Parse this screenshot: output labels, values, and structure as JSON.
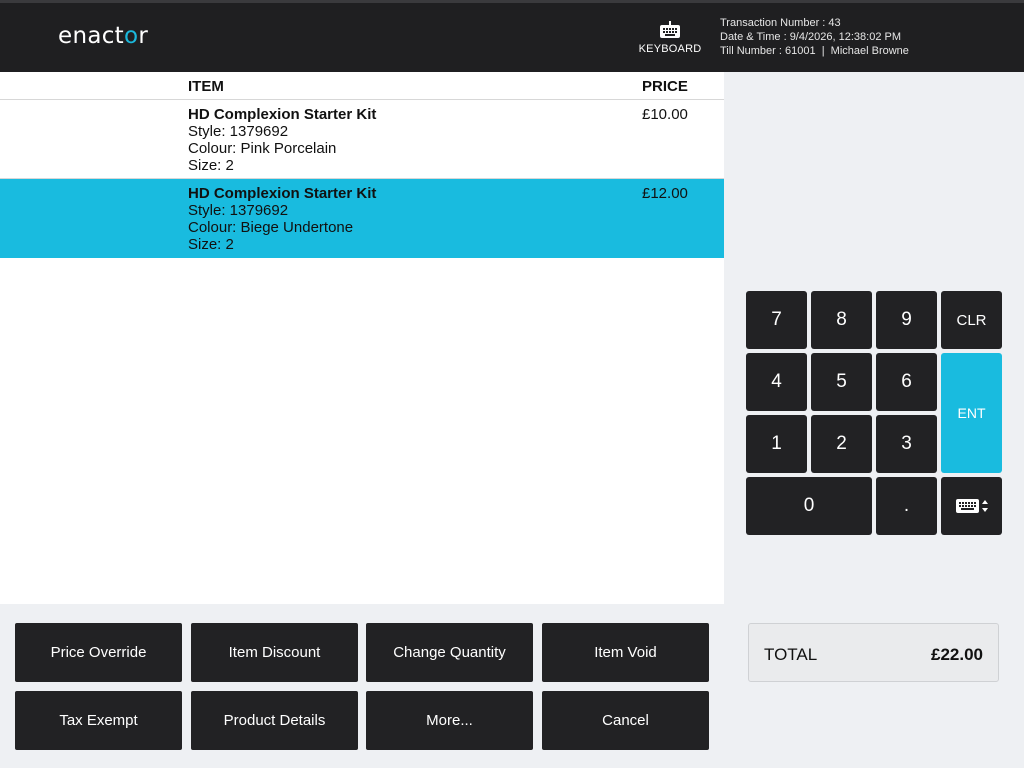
{
  "header": {
    "logo_text": "enactor",
    "keyboard_label": "KEYBOARD",
    "transaction_number": "Transaction Number : 43",
    "date_time": "Date & Time : 9/4/2026, 12:38:02 PM",
    "till_user": "Till Number : 61001  |  Michael Browne"
  },
  "columns": {
    "item": "ITEM",
    "price": "PRICE"
  },
  "items": [
    {
      "name": "HD Complexion Starter Kit",
      "style": "Style: 1379692",
      "colour": "Colour: Pink Porcelain",
      "size": "Size: 2",
      "price": "£10.00",
      "selected": false
    },
    {
      "name": "HD Complexion Starter Kit",
      "style": "Style: 1379692",
      "colour": "Colour: Biege Undertone",
      "size": "Size: 2",
      "price": "£12.00",
      "selected": true
    }
  ],
  "keypad": {
    "k7": "7",
    "k8": "8",
    "k9": "9",
    "clr": "CLR",
    "k4": "4",
    "k5": "5",
    "k6": "6",
    "ent": "ENT",
    "k1": "1",
    "k2": "2",
    "k3": "3",
    "k0": "0",
    "dot": "."
  },
  "actions": {
    "price_override": "Price Override",
    "item_discount": "Item Discount",
    "change_quantity": "Change Quantity",
    "item_void": "Item Void",
    "tax_exempt": "Tax Exempt",
    "product_details": "Product Details",
    "more": "More...",
    "cancel": "Cancel"
  },
  "total": {
    "label": "TOTAL",
    "value": "£22.00"
  },
  "colors": {
    "header_bg": "#1f1f21",
    "accent": "#19bbdf",
    "button_bg": "#222224"
  },
  "icons": {
    "keyboard": "keyboard-icon",
    "keypad_toggle": "keyboard-toggle-icon"
  }
}
